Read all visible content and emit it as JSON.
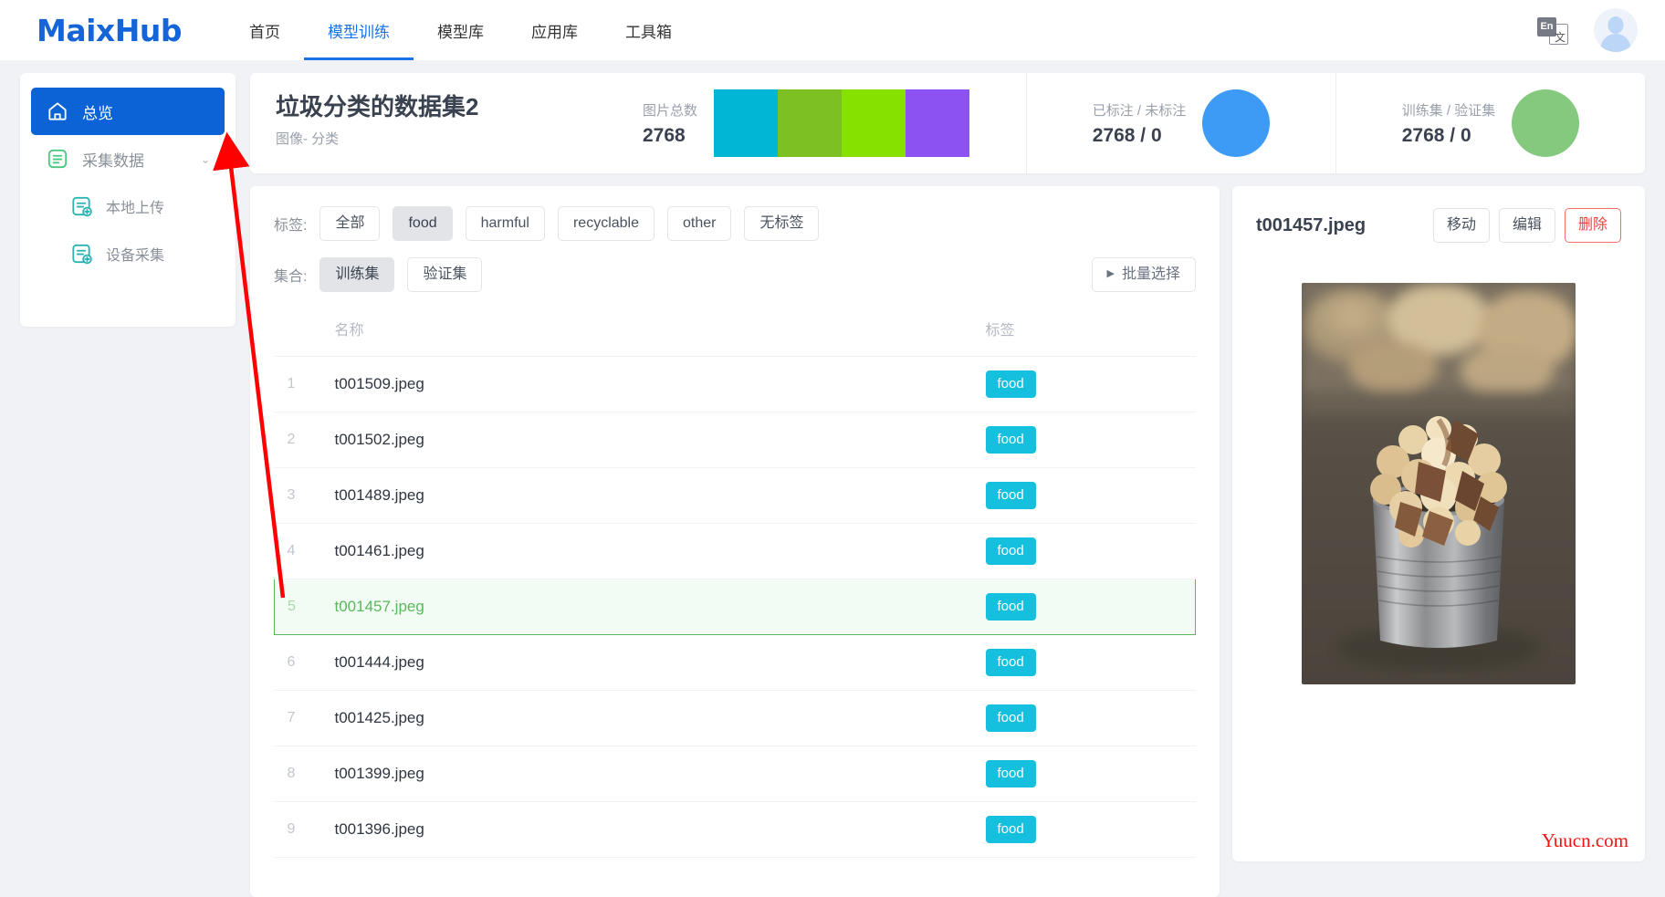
{
  "header": {
    "logo": "MaixHub",
    "nav": [
      {
        "label": "首页",
        "active": false
      },
      {
        "label": "模型训练",
        "active": true
      },
      {
        "label": "模型库",
        "active": false
      },
      {
        "label": "应用库",
        "active": false
      },
      {
        "label": "工具箱",
        "active": false
      }
    ],
    "lang_switch": {
      "primary": "En",
      "secondary": "文"
    }
  },
  "sidebar": {
    "items": [
      {
        "label": "总览",
        "icon": "home-icon",
        "active": true
      },
      {
        "label": "采集数据",
        "icon": "document-list-icon",
        "active": false,
        "expanded": true,
        "chevron": "⌃"
      },
      {
        "label": "本地上传",
        "icon": "document-upload-icon",
        "active": false,
        "sub": true
      },
      {
        "label": "设备采集",
        "icon": "document-device-icon",
        "active": false,
        "sub": true
      }
    ]
  },
  "summary": {
    "dataset_title": "垃圾分类的数据集2",
    "dataset_subtitle": "图像- 分类",
    "stats": [
      {
        "label": "图片总数",
        "value": "2768",
        "viz": "bars"
      },
      {
        "label": "已标注 / 未标注",
        "value": "2768 / 0",
        "viz": "donut",
        "color": "#3d9bf5"
      },
      {
        "label": "训练集 / 验证集",
        "value": "2768 / 0",
        "viz": "donut",
        "color": "#85c97f"
      }
    ],
    "bar_colors": [
      "#00b6d4",
      "#7cc023",
      "#86e000",
      "#8c52f2"
    ]
  },
  "filters": {
    "tag_label": "标签:",
    "tags": [
      {
        "label": "全部",
        "selected": false
      },
      {
        "label": "food",
        "selected": true
      },
      {
        "label": "harmful",
        "selected": false
      },
      {
        "label": "recyclable",
        "selected": false
      },
      {
        "label": "other",
        "selected": false
      },
      {
        "label": "无标签",
        "selected": false
      }
    ],
    "set_label": "集合:",
    "sets": [
      {
        "label": "训练集",
        "selected": true
      },
      {
        "label": "验证集",
        "selected": false
      }
    ],
    "batch_select": {
      "label": "批量选择",
      "triangle": "▶"
    }
  },
  "table": {
    "columns": [
      "",
      "名称",
      "标签"
    ],
    "rows": [
      {
        "idx": "1",
        "name": "t001509.jpeg",
        "tag": "food",
        "selected": false
      },
      {
        "idx": "2",
        "name": "t001502.jpeg",
        "tag": "food",
        "selected": false
      },
      {
        "idx": "3",
        "name": "t001489.jpeg",
        "tag": "food",
        "selected": false
      },
      {
        "idx": "4",
        "name": "t001461.jpeg",
        "tag": "food",
        "selected": false
      },
      {
        "idx": "5",
        "name": "t001457.jpeg",
        "tag": "food",
        "selected": true
      },
      {
        "idx": "6",
        "name": "t001444.jpeg",
        "tag": "food",
        "selected": false
      },
      {
        "idx": "7",
        "name": "t001425.jpeg",
        "tag": "food",
        "selected": false
      },
      {
        "idx": "8",
        "name": "t001399.jpeg",
        "tag": "food",
        "selected": false
      },
      {
        "idx": "9",
        "name": "t001396.jpeg",
        "tag": "food",
        "selected": false
      }
    ],
    "tag_color": "#15c0de",
    "selected_row_color": "#5cb85c"
  },
  "detail": {
    "filename": "t001457.jpeg",
    "buttons": [
      {
        "label": "移动",
        "style": "default"
      },
      {
        "label": "编辑",
        "style": "default"
      },
      {
        "label": "删除",
        "style": "danger"
      }
    ],
    "preview_alt": "caramel-popcorn-in-tin-can"
  },
  "watermark": "Yuucn.com",
  "annotation": {
    "arrow_color": "#ff0000"
  }
}
